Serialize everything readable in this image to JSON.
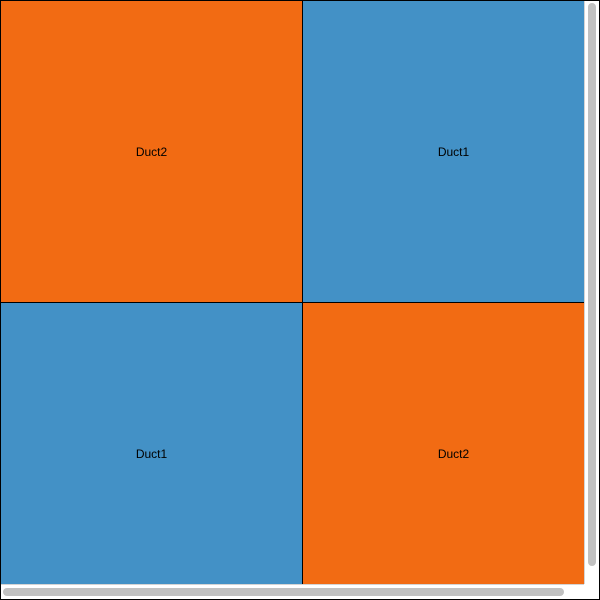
{
  "grid": {
    "cells": [
      {
        "label": "Duct2",
        "color": "#f26b13"
      },
      {
        "label": "Duct1",
        "color": "#4391c6"
      },
      {
        "label": "Duct1",
        "color": "#4391c6"
      },
      {
        "label": "Duct2",
        "color": "#f26b13"
      }
    ]
  }
}
